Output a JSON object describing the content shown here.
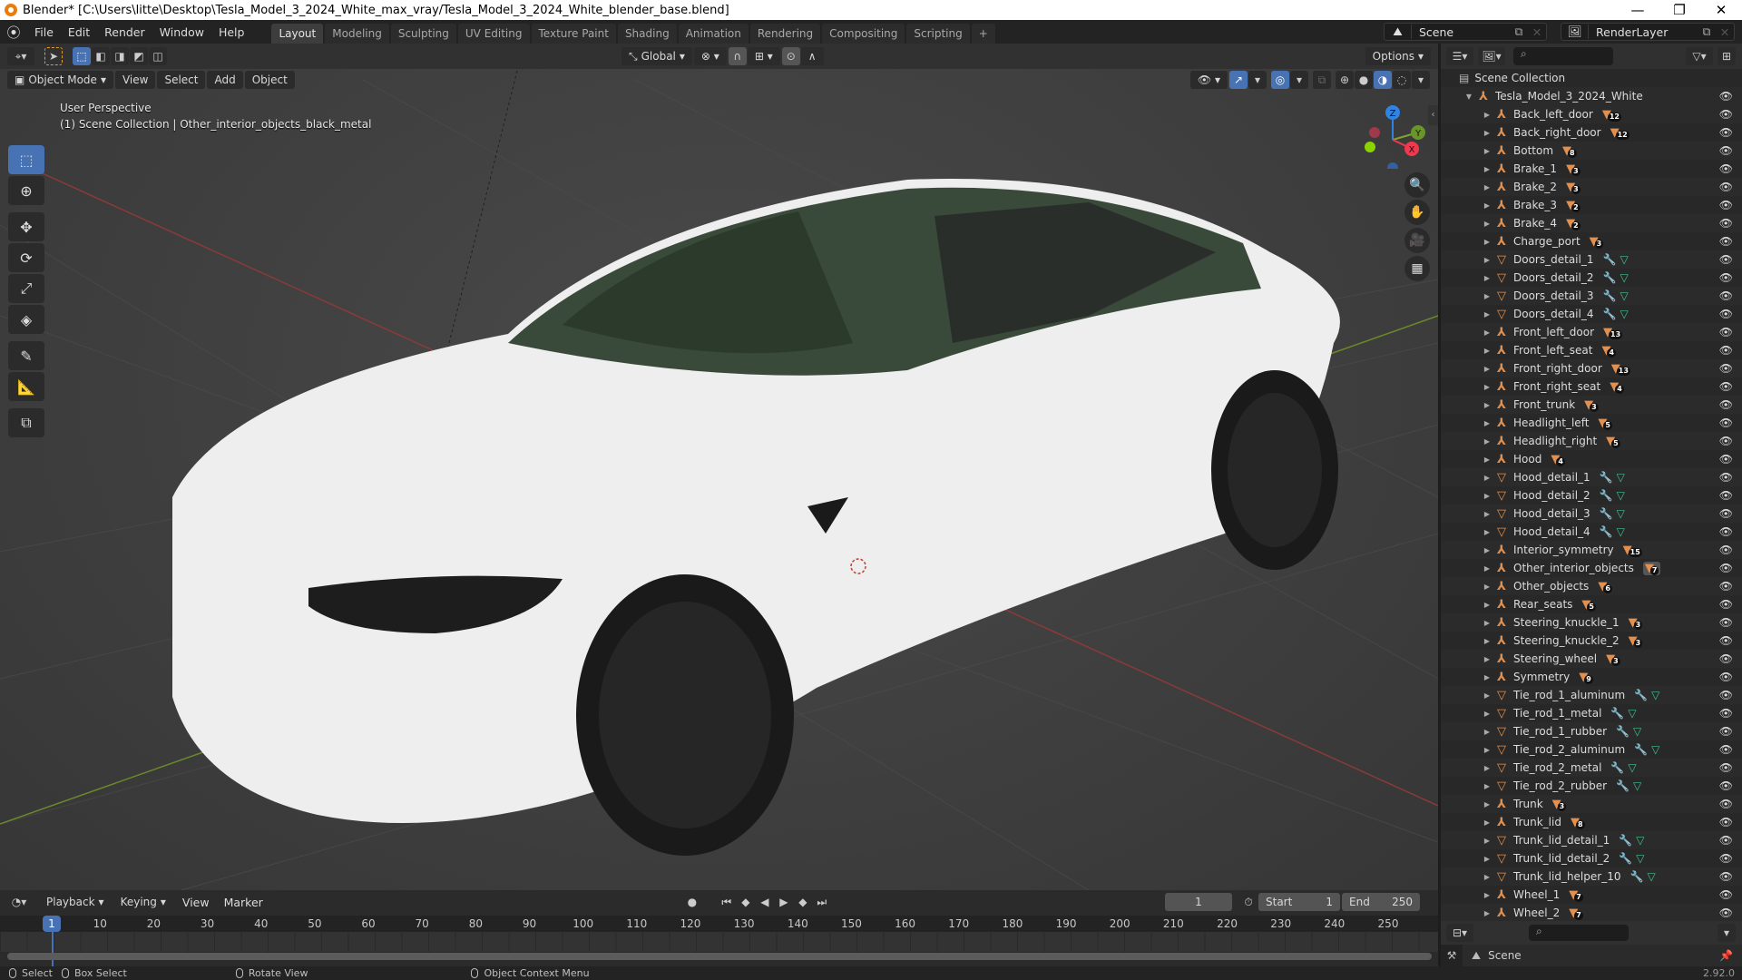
{
  "window": {
    "title": "Blender* [C:\\Users\\litte\\Desktop\\Tesla_Model_3_2024_White_max_vray/Tesla_Model_3_2024_White_blender_base.blend]",
    "minimize": "—",
    "maximize": "❐",
    "close": "✕"
  },
  "topbar": {
    "menus": [
      "File",
      "Edit",
      "Render",
      "Window",
      "Help"
    ],
    "workspaces": [
      "Layout",
      "Modeling",
      "Sculpting",
      "UV Editing",
      "Texture Paint",
      "Shading",
      "Animation",
      "Rendering",
      "Compositing",
      "Scripting"
    ],
    "active_workspace": "Layout",
    "add_workspace": "+",
    "scene": "Scene",
    "view_layer": "RenderLayer"
  },
  "viewport": {
    "mode": "Object Mode",
    "menus": [
      "View",
      "Select",
      "Add",
      "Object"
    ],
    "orientation": "Global",
    "options": "Options",
    "view_name": "User Perspective",
    "context": "(1) Scene Collection | Other_interior_objects_black_metal",
    "gizmo_axes": {
      "x": "X",
      "y": "Y",
      "z": "Z"
    },
    "colors": {
      "x": "#f0384f",
      "y": "#7aa62a",
      "z": "#2f84e3",
      "accent": "#4772b3"
    }
  },
  "toolbar": {
    "tools": [
      {
        "name": "select-box",
        "icon": "⬚"
      },
      {
        "name": "cursor",
        "icon": "⊕"
      },
      {
        "name": "move",
        "icon": "✥"
      },
      {
        "name": "rotate",
        "icon": "⟳"
      },
      {
        "name": "scale",
        "icon": "⤢"
      },
      {
        "name": "transform",
        "icon": "◈"
      },
      {
        "name": "annotate",
        "icon": "✎"
      },
      {
        "name": "measure",
        "icon": "📐"
      },
      {
        "name": "add-cube",
        "icon": "⧉"
      }
    ]
  },
  "outliner": {
    "root": "Scene Collection",
    "collection": "Tesla_Model_3_2024_White",
    "items": [
      {
        "name": "Back_left_door",
        "type": "empty",
        "children": "12"
      },
      {
        "name": "Back_right_door",
        "type": "empty",
        "children": "12"
      },
      {
        "name": "Bottom",
        "type": "empty",
        "children": "8"
      },
      {
        "name": "Brake_1",
        "type": "empty",
        "children": "3"
      },
      {
        "name": "Brake_2",
        "type": "empty",
        "children": "3"
      },
      {
        "name": "Brake_3",
        "type": "empty",
        "children": "2"
      },
      {
        "name": "Brake_4",
        "type": "empty",
        "children": "2"
      },
      {
        "name": "Charge_port",
        "type": "empty",
        "children": "3"
      },
      {
        "name": "Doors_detail_1",
        "type": "mesh"
      },
      {
        "name": "Doors_detail_2",
        "type": "mesh"
      },
      {
        "name": "Doors_detail_3",
        "type": "mesh"
      },
      {
        "name": "Doors_detail_4",
        "type": "mesh"
      },
      {
        "name": "Front_left_door",
        "type": "empty",
        "children": "13"
      },
      {
        "name": "Front_left_seat",
        "type": "empty",
        "children": "4"
      },
      {
        "name": "Front_right_door",
        "type": "empty",
        "children": "13"
      },
      {
        "name": "Front_right_seat",
        "type": "empty",
        "children": "4"
      },
      {
        "name": "Front_trunk",
        "type": "empty",
        "children": "3"
      },
      {
        "name": "Headlight_left",
        "type": "empty",
        "children": "5"
      },
      {
        "name": "Headlight_right",
        "type": "empty",
        "children": "5"
      },
      {
        "name": "Hood",
        "type": "empty",
        "children": "4"
      },
      {
        "name": "Hood_detail_1",
        "type": "mesh"
      },
      {
        "name": "Hood_detail_2",
        "type": "mesh"
      },
      {
        "name": "Hood_detail_3",
        "type": "mesh"
      },
      {
        "name": "Hood_detail_4",
        "type": "mesh"
      },
      {
        "name": "Interior_symmetry",
        "type": "empty",
        "children": "15"
      },
      {
        "name": "Other_interior_objects",
        "type": "empty",
        "children": "7",
        "selected_child": true
      },
      {
        "name": "Other_objects",
        "type": "empty",
        "children": "6"
      },
      {
        "name": "Rear_seats",
        "type": "empty",
        "children": "5"
      },
      {
        "name": "Steering_knuckle_1",
        "type": "empty",
        "children": "3"
      },
      {
        "name": "Steering_knuckle_2",
        "type": "empty",
        "children": "3"
      },
      {
        "name": "Steering_wheel",
        "type": "empty",
        "children": "3"
      },
      {
        "name": "Symmetry",
        "type": "empty",
        "children": "9"
      },
      {
        "name": "Tie_rod_1_aluminum",
        "type": "mesh"
      },
      {
        "name": "Tie_rod_1_metal",
        "type": "mesh"
      },
      {
        "name": "Tie_rod_1_rubber",
        "type": "mesh"
      },
      {
        "name": "Tie_rod_2_aluminum",
        "type": "mesh"
      },
      {
        "name": "Tie_rod_2_metal",
        "type": "mesh"
      },
      {
        "name": "Tie_rod_2_rubber",
        "type": "mesh"
      },
      {
        "name": "Trunk",
        "type": "empty",
        "children": "3"
      },
      {
        "name": "Trunk_lid",
        "type": "empty",
        "children": "8"
      },
      {
        "name": "Trunk_lid_detail_1",
        "type": "mesh"
      },
      {
        "name": "Trunk_lid_detail_2",
        "type": "mesh"
      },
      {
        "name": "Trunk_lid_helper_10",
        "type": "mesh"
      },
      {
        "name": "Wheel_1",
        "type": "empty",
        "children": "7"
      },
      {
        "name": "Wheel_2",
        "type": "empty",
        "children": "7"
      }
    ]
  },
  "properties": {
    "tab": "Scene"
  },
  "timeline": {
    "menus": [
      "Playback",
      "Keying",
      "View",
      "Marker"
    ],
    "current_frame": "1",
    "start_label": "Start",
    "start": "1",
    "end_label": "End",
    "end": "250",
    "ticks": [
      "10",
      "20",
      "30",
      "40",
      "50",
      "60",
      "70",
      "80",
      "90",
      "100",
      "110",
      "120",
      "130",
      "140",
      "150",
      "160",
      "170",
      "180",
      "190",
      "200",
      "210",
      "220",
      "230",
      "240",
      "250"
    ]
  },
  "statusbar": {
    "select": "Select",
    "box_select": "Box Select",
    "rotate": "Rotate View",
    "context_menu": "Object Context Menu",
    "version": "2.92.0"
  }
}
